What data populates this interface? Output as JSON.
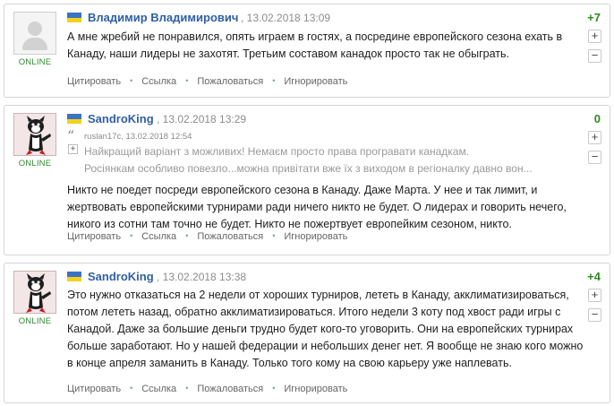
{
  "actions": {
    "quote": "Цитировать",
    "link": "Ссылка",
    "report": "Пожаловаться",
    "ignore": "Игнорировать",
    "separator": "•"
  },
  "vote": {
    "plus": "+",
    "minus": "−"
  },
  "comments": [
    {
      "author": "Владимир Владимирович",
      "datetime": ", 13.02.2018 13:09",
      "score": "+7",
      "status": "ONLINE",
      "text": "А мне жребий не понравился, опять играем в гостях, а посредине европейского сезона ехать в Канаду, наши лидеры не захотят. Третьим составом канадок просто так не обыграть."
    },
    {
      "author": "SandroKing",
      "datetime": ", 13.02.2018 13:29",
      "score": "0",
      "status": "ONLINE",
      "quote": {
        "icon": "“",
        "expand": "+",
        "meta": "ruslan17c, 13.02.2018 12:54",
        "line1": "Найкращий варіант з можливих! Немаєм просто права програвати канадкам.",
        "line2": "Росіянкам особливо повезло...можна привітати вже їх з виходом в регіоналку давно вон..."
      },
      "text": "Никто не поедет посреди европейского сезона в Канаду. Даже Марта. У нее и так лимит, и жертвовать европейскими турнирами ради ничего никто не будет. О лидерах и говорить нечего, никого из сотни там точно не будет. Никто не пожертвует европейким сезоном, никто."
    },
    {
      "author": "SandroKing",
      "datetime": ", 13.02.2018 13:38",
      "score": "+4",
      "status": "ONLINE",
      "text": "Это нужно отказаться на 2 недели от хороших турниров, лететь в Канаду, акклиматизироваться, потом лететь назад, обратно акклиматизироваться. Итого недели 3 коту под хвост ради игры с Канадой. Даже за большие деньги трудно будет кого-то уговорить. Они на европейских турнирах больше заработают. Но у нашей федерации и небольших денег нет. Я вообще не знаю кого можно в конце апреля заманить в Канаду. Только того кому на свою карьеру уже наплевать."
    }
  ],
  "colors": {
    "author": "#2f5fa6",
    "score": "#2e8b1e",
    "online": "#2f8a2f",
    "flag_blue": "#3b73c4",
    "flag_yellow": "#f4d21c"
  }
}
